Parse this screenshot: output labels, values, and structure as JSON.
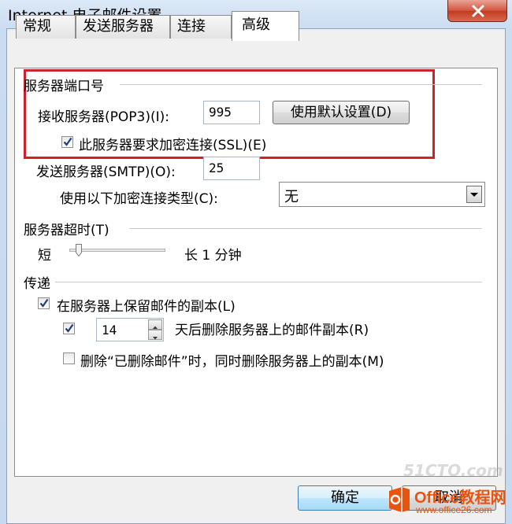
{
  "window": {
    "title": "Internet 电子邮件设置"
  },
  "tabs": [
    {
      "label": "常规"
    },
    {
      "label": "发送服务器"
    },
    {
      "label": "连接"
    },
    {
      "label": "高级"
    }
  ],
  "server_ports": {
    "group_label": "服务器端口号",
    "incoming_label": "接收服务器(POP3)(I):",
    "incoming_value": "995",
    "default_button": "使用默认设置(D)",
    "ssl_label": "此服务器要求加密连接(SSL)(E)",
    "ssl_checked": true,
    "outgoing_label": "发送服务器(SMTP)(O):",
    "outgoing_value": "25",
    "encryption_label": "使用以下加密连接类型(C):",
    "encryption_value": "无"
  },
  "timeout": {
    "group_label": "服务器超时(T)",
    "short_label": "短",
    "long_label": "长 1 分钟",
    "slider_level": 0.08
  },
  "delivery": {
    "group_label": "传递",
    "leave_copy_label": "在服务器上保留邮件的副本(L)",
    "leave_copy_checked": true,
    "remove_after_checked": true,
    "remove_after_days": "14",
    "remove_after_label": "天后删除服务器上的邮件副本(R)",
    "remove_deleted_label": "删除“已删除邮件”时，同时删除服务器上的副本(M)",
    "remove_deleted_checked": false
  },
  "footer": {
    "ok_label": "确定",
    "cancel_label": "取消"
  },
  "watermarks": {
    "site_cn": "Office教程网",
    "site_url": "www.office26.com",
    "faint": "51CTO.com"
  },
  "colors": {
    "highlight": "#d0202a",
    "watermark": "#e8540e"
  }
}
